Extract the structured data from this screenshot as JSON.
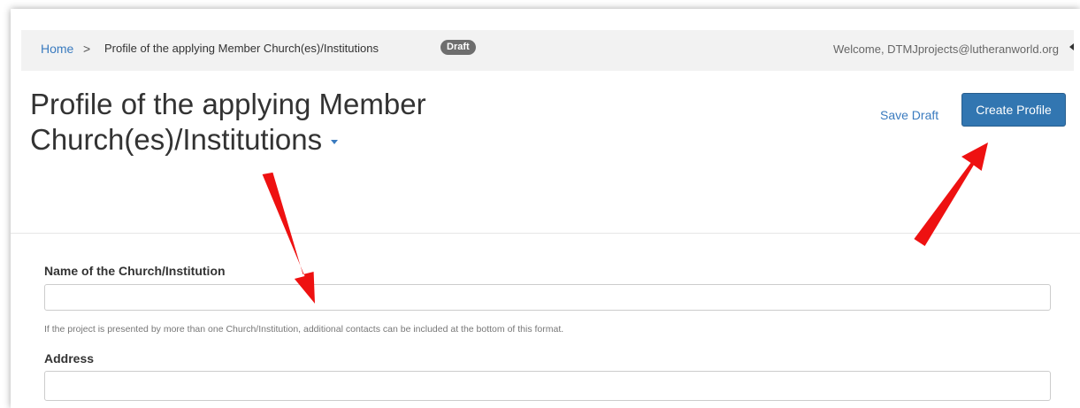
{
  "breadcrumb": {
    "home": "Home",
    "separator": ">",
    "current": "Profile of the applying Member Church(es)/Institutions",
    "badge": "Draft"
  },
  "header": {
    "welcome": "Welcome, DTMJprojects@lutheranworld.org"
  },
  "page": {
    "title_line1": "Profile of the applying Member",
    "title_line2": "Church(es)/Institutions"
  },
  "actions": {
    "save_draft": "Save Draft",
    "create_profile": "Create Profile"
  },
  "form": {
    "name_label": "Name of the Church/Institution",
    "name_value": "",
    "name_help": "If the project is presented by more than one Church/Institution, additional contacts can be included at the bottom of this format.",
    "address_label": "Address",
    "address_value": ""
  },
  "colors": {
    "primary": "#3276b1",
    "link": "#3a7bbf",
    "annotation_arrow": "#ee1111",
    "topbar_bg": "#f2f2f2",
    "badge_bg": "#6e6e6e"
  },
  "icons": {
    "title_dropdown": "caret-down-icon",
    "topbar_toggle": "caret-left-icon",
    "annotations": [
      "red-arrow-down-icon",
      "red-arrow-up-icon"
    ]
  }
}
